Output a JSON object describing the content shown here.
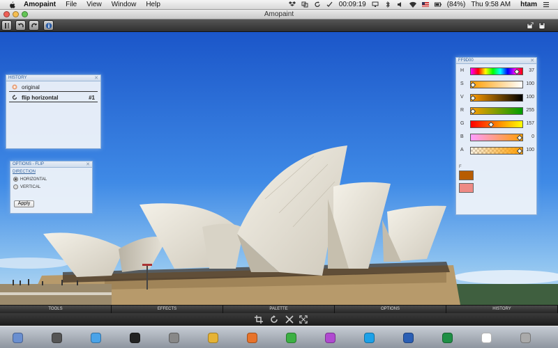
{
  "menubar": {
    "app_name": "Amopaint",
    "menus": [
      "File",
      "View",
      "Window",
      "Help"
    ],
    "clock_timer": "00:09:19",
    "battery": "(84%)",
    "datetime": "Thu 9:58 AM",
    "user": "htam",
    "status_icons": [
      "dropbox-icon",
      "sync-icon",
      "timer-icon",
      "display-icon",
      "bluetooth-icon",
      "volume-icon",
      "wifi-icon",
      "flag-icon",
      "battery-icon"
    ]
  },
  "window": {
    "title": "Amopaint"
  },
  "toolbar": {
    "left_buttons": [
      "layers-icon",
      "undo-icon",
      "redo-icon",
      "info-icon"
    ],
    "right_buttons": [
      "save-icon",
      "export-icon"
    ]
  },
  "history_panel": {
    "title": "HISTORY",
    "items": [
      {
        "label": "original",
        "number": "",
        "active": false
      },
      {
        "label": "flip horizontal",
        "number": "#1",
        "active": true
      }
    ]
  },
  "options_panel": {
    "title": "OPTIONS - FLIP",
    "section": "DIRECTION",
    "options": [
      {
        "label": "HORIZONTAL",
        "selected": true
      },
      {
        "label": "VERTICAL",
        "selected": false
      }
    ],
    "apply_label": "Apply"
  },
  "color_panel": {
    "title": "FF9D00",
    "sliders": [
      {
        "label": "H",
        "value": "37",
        "fraction": 0.93
      },
      {
        "label": "S",
        "value": "100",
        "fraction": 0.0
      },
      {
        "label": "V",
        "value": "100",
        "fraction": 0.0
      },
      {
        "label": "R",
        "value": "255",
        "fraction": 0.0
      },
      {
        "label": "G",
        "value": "157",
        "fraction": 0.38
      },
      {
        "label": "B",
        "value": "0",
        "fraction": 0.98
      },
      {
        "label": "A",
        "value": "100",
        "fraction": 0.98
      }
    ],
    "swatch_label": "F",
    "colors": {
      "foreground": "#ff9d00",
      "swatch_top": "#b85c00",
      "swatch_bottom": "#ee8a85"
    }
  },
  "bottom_tabs": [
    "TOOLS",
    "EFFECTS",
    "PALETTE",
    "OPTIONS",
    "HISTORY"
  ],
  "bottom_tools": [
    "crop-icon",
    "rotate-icon",
    "flip-icon",
    "resize-icon"
  ],
  "dock": {
    "icons": [
      "finder-icon",
      "launchpad-icon",
      "safari-icon",
      "terminal-icon",
      "system-preferences-icon",
      "chrome-icon",
      "firefox-icon",
      "app-icon",
      "itunes-icon",
      "skype-icon",
      "word-icon",
      "excel-icon",
      "calendar-icon",
      "trash-icon"
    ]
  }
}
